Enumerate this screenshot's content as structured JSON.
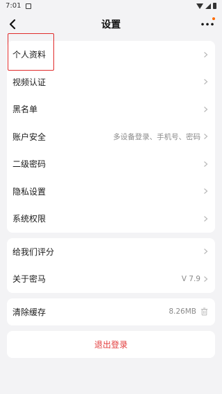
{
  "status_bar": {
    "time": "7:01"
  },
  "nav": {
    "title": "设置"
  },
  "colors": {
    "accent_red": "#e23c3c",
    "notice_dot": "#ff6a00"
  },
  "groups": [
    {
      "items": [
        {
          "label": "个人资料",
          "value": ""
        },
        {
          "label": "视频认证",
          "value": ""
        },
        {
          "label": "黑名单",
          "value": ""
        },
        {
          "label": "账户安全",
          "value": "多设备登录、手机号、密码"
        },
        {
          "label": "二级密码",
          "value": ""
        },
        {
          "label": "隐私设置",
          "value": ""
        },
        {
          "label": "系统权限",
          "value": ""
        }
      ]
    },
    {
      "items": [
        {
          "label": "给我们评分",
          "value": ""
        },
        {
          "label": "关于密马",
          "value": "V 7.9"
        }
      ]
    },
    {
      "items": [
        {
          "label": "清除缓存",
          "value": "8.26MB"
        }
      ]
    }
  ],
  "logout": {
    "label": "退出登录"
  }
}
